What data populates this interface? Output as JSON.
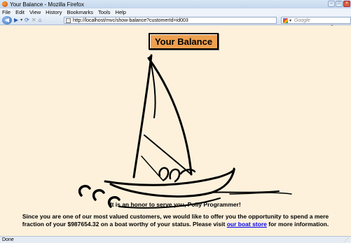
{
  "window": {
    "title": "Your Balance - Mozilla Firefox"
  },
  "menubar": {
    "items": [
      "File",
      "Edit",
      "View",
      "History",
      "Bookmarks",
      "Tools",
      "Help"
    ]
  },
  "navbar": {
    "url": "http://localhost/mvc/show-balance?customerId=id003",
    "search_placeholder": "Google"
  },
  "page": {
    "title": "Your Balance",
    "greeting": "It is an honor to serve you, Polly Programmer!",
    "offer_line1": "Since you are one of our most valued customers, we would like to offer you the opportunity to spend a mere",
    "offer_line2_pre": "fraction of your $987654.32 on a boat worthy of your status. Please visit",
    "offer_link": "our boat store",
    "offer_line2_post": "for more information."
  },
  "statusbar": {
    "text": "Done"
  },
  "colors": {
    "page_bg": "#fdf1dc",
    "title_button": "#eda050",
    "link": "#0000ee",
    "desktop": "#f3b63b"
  }
}
